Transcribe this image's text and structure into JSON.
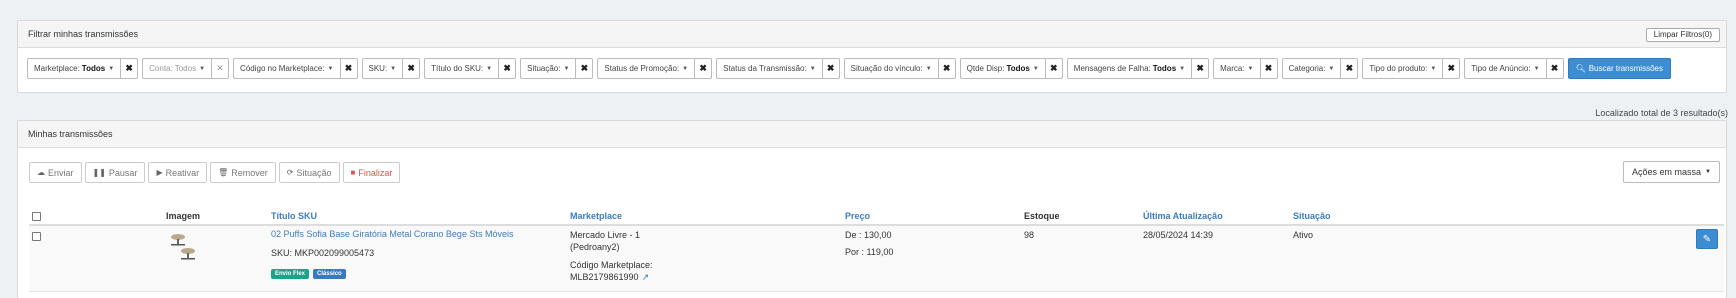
{
  "filter_panel": {
    "title": "Filtrar minhas transmissões",
    "clear_button": "Limpar Filtros(0)",
    "filters": [
      {
        "label": "Marketplace:",
        "value": "Todos",
        "muted": false
      },
      {
        "label": "Conta:",
        "value": "Todos",
        "muted": true
      },
      {
        "label": "Código no Marketplace:",
        "value": "",
        "muted": false
      },
      {
        "label": "SKU:",
        "value": "",
        "muted": false
      },
      {
        "label": "Título do SKU:",
        "value": "",
        "muted": false
      },
      {
        "label": "Situação:",
        "value": "",
        "muted": false
      },
      {
        "label": "Status de Promoção:",
        "value": "",
        "muted": false
      },
      {
        "label": "Status da Transmissão:",
        "value": "",
        "muted": false
      },
      {
        "label": "Situação do vínculo:",
        "value": "",
        "muted": false
      },
      {
        "label": "Qtde Disp:",
        "value": "Todos",
        "muted": false
      },
      {
        "label": "Mensagens de Falha:",
        "value": "Todos",
        "muted": false
      },
      {
        "label": "Marca:",
        "value": "",
        "muted": false
      },
      {
        "label": "Categoria:",
        "value": "",
        "muted": false
      },
      {
        "label": "Tipo do produto:",
        "value": "",
        "muted": false
      },
      {
        "label": "Tipo de Anúncio:",
        "value": "",
        "muted": false
      }
    ],
    "search_button": "Buscar transmissões"
  },
  "results_count": "Localizado total de 3 resultado(s)",
  "list_panel": {
    "title": "Minhas transmissões",
    "toolbar": {
      "send": "Enviar",
      "pause": "Pausar",
      "reactivate": "Reativar",
      "remove": "Remover",
      "status": "Situação",
      "finalize": "Finalizar"
    },
    "bulk_actions": "Ações em massa",
    "columns": {
      "image": "Imagem",
      "sku_title": "Título SKU",
      "marketplace": "Marketplace",
      "price": "Preço",
      "stock": "Estoque",
      "last_update": "Última Atualização",
      "status": "Situação"
    },
    "rows": [
      {
        "title": "02 Puffs Sofia Base Giratória Metal Corano Bege Sts Móveis",
        "sku": "SKU: MKP002099005473",
        "badges": [
          "Envio Flex",
          "Clássico"
        ],
        "marketplace_line1": "Mercado Livre - 1",
        "marketplace_line2": "(Pedroany2)",
        "marketplace_code_label": "Código Marketplace:",
        "marketplace_code": "MLB2179861990",
        "price_from": "De : 130,00",
        "price_to": "Por : 119,00",
        "stock": "98",
        "last_update": "28/05/2024 14:39",
        "status": "Ativo"
      }
    ]
  },
  "colors": {
    "primary": "#3c8dd1",
    "link": "#3c7cc0",
    "danger": "#d9534f",
    "badge_flex": "#1aa58a",
    "badge_classic": "#3a7bbf"
  }
}
